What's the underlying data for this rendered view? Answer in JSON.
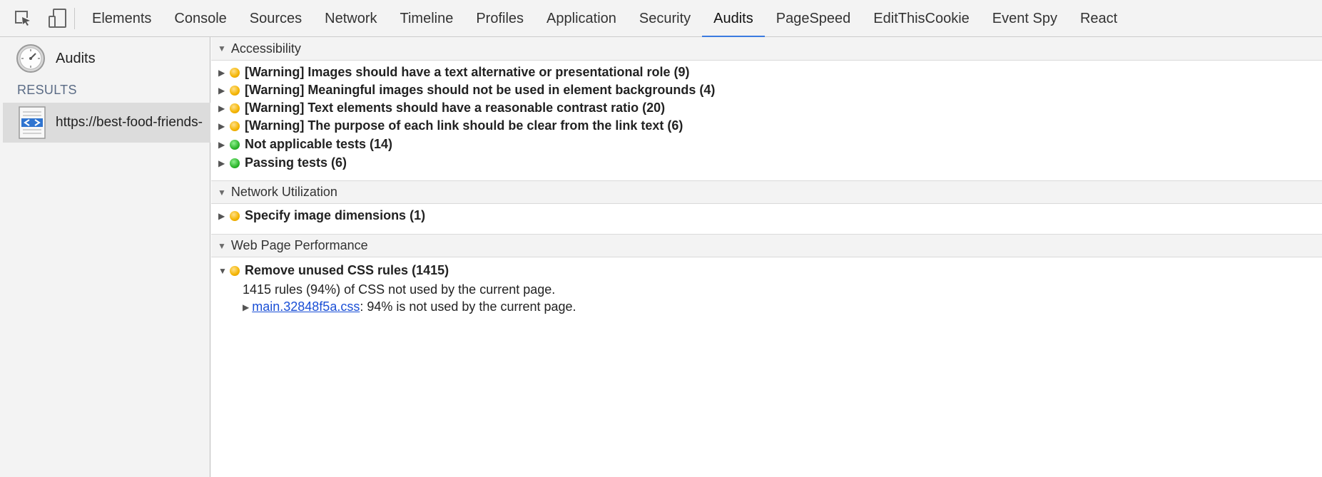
{
  "toolbar": {
    "tabs": [
      {
        "label": "Elements"
      },
      {
        "label": "Console"
      },
      {
        "label": "Sources"
      },
      {
        "label": "Network"
      },
      {
        "label": "Timeline"
      },
      {
        "label": "Profiles"
      },
      {
        "label": "Application"
      },
      {
        "label": "Security"
      },
      {
        "label": "Audits",
        "active": true
      },
      {
        "label": "PageSpeed"
      },
      {
        "label": "EditThisCookie"
      },
      {
        "label": "Event Spy"
      },
      {
        "label": "React"
      }
    ],
    "accent_color": "#3b7be0"
  },
  "sidebar": {
    "audits_label": "Audits",
    "results_heading": "RESULTS",
    "result_item": "https://best-food-friends-"
  },
  "main": {
    "accessibility": {
      "header": "Accessibility",
      "items": [
        {
          "status": "warning",
          "text": "[Warning] Images should have a text alternative or presentational role (9)"
        },
        {
          "status": "warning",
          "text": "[Warning] Meaningful images should not be used in element backgrounds (4)"
        },
        {
          "status": "warning",
          "text": "[Warning] Text elements should have a reasonable contrast ratio (20)"
        },
        {
          "status": "warning",
          "text": "[Warning] The purpose of each link should be clear from the link text (6)"
        },
        {
          "status": "pass",
          "text": "Not applicable tests (14)"
        },
        {
          "status": "pass",
          "text": "Passing tests (6)"
        }
      ]
    },
    "network": {
      "header": "Network Utilization",
      "items": [
        {
          "status": "warning",
          "text": "Specify image dimensions (1)"
        }
      ]
    },
    "performance": {
      "header": "Web Page Performance",
      "item": {
        "status": "warning",
        "text": "Remove unused CSS rules (1415)"
      },
      "detail": "1415 rules (94%) of CSS not used by the current page.",
      "sub_link": "main.32848f5a.css",
      "sub_text": ": 94% is not used by the current page."
    }
  },
  "colors": {
    "warning": "#f4b400",
    "pass": "#2cb52c",
    "link": "#1a4fd6"
  }
}
